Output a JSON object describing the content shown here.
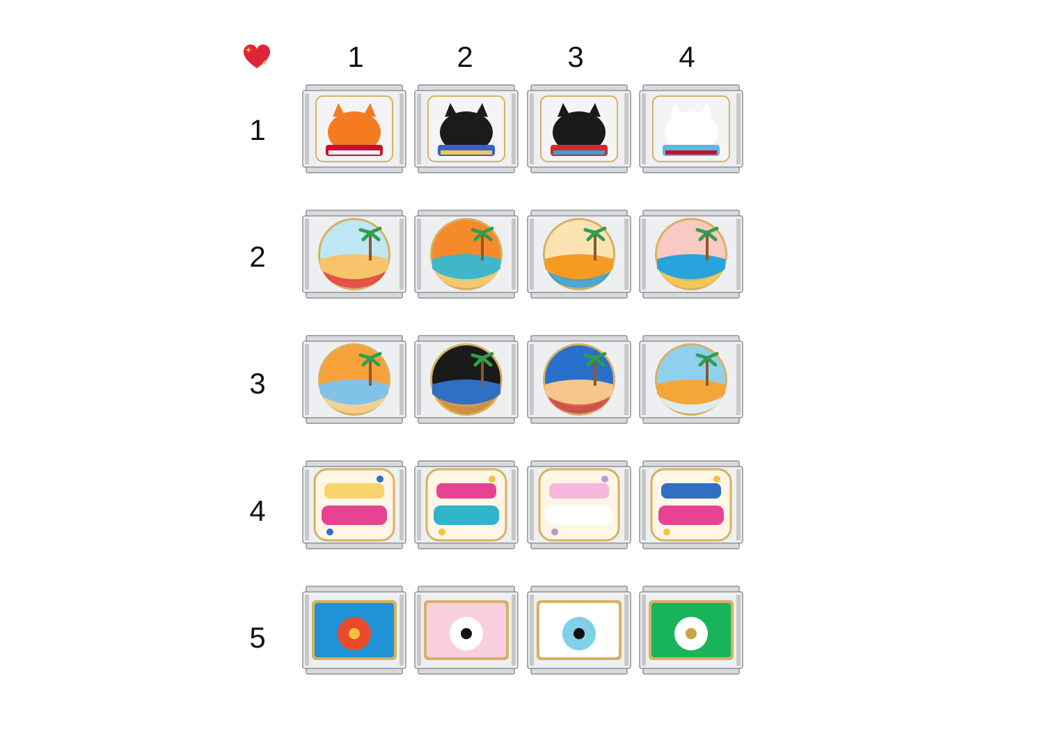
{
  "header": {
    "corner_icon": "sparkling-heart-icon"
  },
  "columns": [
    "1",
    "2",
    "3",
    "4"
  ],
  "rows": [
    {
      "label": "1",
      "charms": [
        {
          "icon": "orange-cat-reading-book-icon",
          "colors": [
            "#f47b20",
            "#c8102e",
            "#e8f1fb"
          ]
        },
        {
          "icon": "cat-on-branch-starry-night-icon",
          "colors": [
            "#1b1b1b",
            "#3a5fcd",
            "#f2c94c"
          ]
        },
        {
          "icon": "black-cat-red-book-icon",
          "colors": [
            "#1a1a1a",
            "#d62828",
            "#3aa0d8"
          ]
        },
        {
          "icon": "white-cat-on-books-icon",
          "colors": [
            "#ffffff",
            "#5bb8e0",
            "#c8102e"
          ]
        }
      ]
    },
    {
      "label": "2",
      "charms": [
        {
          "icon": "beach-umbrella-palm-icon",
          "colors": [
            "#bfe6f3",
            "#f7c46c",
            "#e63b2e"
          ]
        },
        {
          "icon": "island-palm-surfboard-icon",
          "colors": [
            "#f58a2a",
            "#3fb6c9",
            "#f2d27a"
          ]
        },
        {
          "icon": "sunset-hammock-icon",
          "colors": [
            "#fde3b4",
            "#f59a23",
            "#2f9ed8"
          ]
        },
        {
          "icon": "beach-chairs-umbrella-icon",
          "colors": [
            "#f9c9c3",
            "#2aa3dc",
            "#f4c545"
          ]
        }
      ]
    },
    {
      "label": "3",
      "charms": [
        {
          "icon": "mountain-sunset-beach-icon",
          "colors": [
            "#f7a13a",
            "#7fc3e8",
            "#f6d6a0"
          ]
        },
        {
          "icon": "night-beach-tent-icon",
          "colors": [
            "#1a1a1a",
            "#2f6fc4",
            "#f2a54a"
          ]
        },
        {
          "icon": "beach-ball-lifebuoy-icon",
          "colors": [
            "#2a6fc9",
            "#f6c68a",
            "#e84c3d"
          ]
        },
        {
          "icon": "beach-tent-palm-icon",
          "colors": [
            "#8fd0ef",
            "#f4a63a",
            "#e7f3f8"
          ]
        }
      ]
    },
    {
      "label": "4",
      "charms": [
        {
          "icon": "keep-creating-lettering-icon",
          "colors": [
            "#f6d36b",
            "#e84393",
            "#2f6fc4"
          ]
        },
        {
          "icon": "keep-smiling-lettering-icon",
          "colors": [
            "#e84393",
            "#2fb4c9",
            "#f6c23e"
          ]
        },
        {
          "icon": "harry-styles-heart-icon",
          "colors": [
            "#f6b7dc",
            "#ffffff",
            "#b79bd0"
          ]
        },
        {
          "icon": "keep-reading-lettering-icon",
          "colors": [
            "#2f6fc4",
            "#e84393",
            "#f6c23e"
          ]
        }
      ]
    },
    {
      "label": "5",
      "charms": [
        {
          "icon": "rainbow-icon",
          "colors": [
            "#1f93d6",
            "#e94b2b",
            "#f5c33b"
          ]
        },
        {
          "icon": "pink-evil-eye-icon",
          "colors": [
            "#f9cfe0",
            "#ffffff",
            "#111111"
          ]
        },
        {
          "icon": "blue-evil-eye-icon",
          "colors": [
            "#ffffff",
            "#7fd0e8",
            "#111111"
          ]
        },
        {
          "icon": "green-leaf-icon",
          "colors": [
            "#19b35a",
            "#ffffff",
            "#c9a24a"
          ]
        }
      ]
    }
  ],
  "colors": {
    "steel": "#d9dadd",
    "steel_dark": "#8f9196",
    "gold": "#d6b160"
  }
}
